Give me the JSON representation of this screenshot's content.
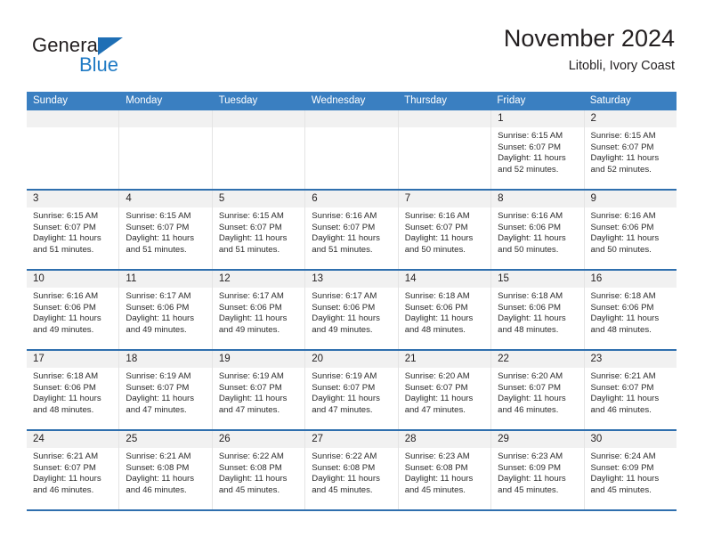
{
  "brand": {
    "name_part1": "General",
    "name_part2": "Blue",
    "logo_icon": "triangle-logo-icon"
  },
  "header": {
    "title": "November 2024",
    "subtitle": "Litobli, Ivory Coast"
  },
  "colors": {
    "header_blue": "#3a7fc1",
    "row_rule_blue": "#2f6fae",
    "day_band_gray": "#f1f1f1",
    "brand_blue": "#1f7ac4",
    "text": "#231f20"
  },
  "weekdays": [
    "Sunday",
    "Monday",
    "Tuesday",
    "Wednesday",
    "Thursday",
    "Friday",
    "Saturday"
  ],
  "weeks": [
    [
      {
        "day": "",
        "empty": true,
        "sunrise": "",
        "sunset": "",
        "daylight_l1": "",
        "daylight_l2": ""
      },
      {
        "day": "",
        "empty": true,
        "sunrise": "",
        "sunset": "",
        "daylight_l1": "",
        "daylight_l2": ""
      },
      {
        "day": "",
        "empty": true,
        "sunrise": "",
        "sunset": "",
        "daylight_l1": "",
        "daylight_l2": ""
      },
      {
        "day": "",
        "empty": true,
        "sunrise": "",
        "sunset": "",
        "daylight_l1": "",
        "daylight_l2": ""
      },
      {
        "day": "",
        "empty": true,
        "sunrise": "",
        "sunset": "",
        "daylight_l1": "",
        "daylight_l2": ""
      },
      {
        "day": "1",
        "empty": false,
        "sunrise": "Sunrise: 6:15 AM",
        "sunset": "Sunset: 6:07 PM",
        "daylight_l1": "Daylight: 11 hours",
        "daylight_l2": "and 52 minutes."
      },
      {
        "day": "2",
        "empty": false,
        "sunrise": "Sunrise: 6:15 AM",
        "sunset": "Sunset: 6:07 PM",
        "daylight_l1": "Daylight: 11 hours",
        "daylight_l2": "and 52 minutes."
      }
    ],
    [
      {
        "day": "3",
        "empty": false,
        "sunrise": "Sunrise: 6:15 AM",
        "sunset": "Sunset: 6:07 PM",
        "daylight_l1": "Daylight: 11 hours",
        "daylight_l2": "and 51 minutes."
      },
      {
        "day": "4",
        "empty": false,
        "sunrise": "Sunrise: 6:15 AM",
        "sunset": "Sunset: 6:07 PM",
        "daylight_l1": "Daylight: 11 hours",
        "daylight_l2": "and 51 minutes."
      },
      {
        "day": "5",
        "empty": false,
        "sunrise": "Sunrise: 6:15 AM",
        "sunset": "Sunset: 6:07 PM",
        "daylight_l1": "Daylight: 11 hours",
        "daylight_l2": "and 51 minutes."
      },
      {
        "day": "6",
        "empty": false,
        "sunrise": "Sunrise: 6:16 AM",
        "sunset": "Sunset: 6:07 PM",
        "daylight_l1": "Daylight: 11 hours",
        "daylight_l2": "and 51 minutes."
      },
      {
        "day": "7",
        "empty": false,
        "sunrise": "Sunrise: 6:16 AM",
        "sunset": "Sunset: 6:07 PM",
        "daylight_l1": "Daylight: 11 hours",
        "daylight_l2": "and 50 minutes."
      },
      {
        "day": "8",
        "empty": false,
        "sunrise": "Sunrise: 6:16 AM",
        "sunset": "Sunset: 6:06 PM",
        "daylight_l1": "Daylight: 11 hours",
        "daylight_l2": "and 50 minutes."
      },
      {
        "day": "9",
        "empty": false,
        "sunrise": "Sunrise: 6:16 AM",
        "sunset": "Sunset: 6:06 PM",
        "daylight_l1": "Daylight: 11 hours",
        "daylight_l2": "and 50 minutes."
      }
    ],
    [
      {
        "day": "10",
        "empty": false,
        "sunrise": "Sunrise: 6:16 AM",
        "sunset": "Sunset: 6:06 PM",
        "daylight_l1": "Daylight: 11 hours",
        "daylight_l2": "and 49 minutes."
      },
      {
        "day": "11",
        "empty": false,
        "sunrise": "Sunrise: 6:17 AM",
        "sunset": "Sunset: 6:06 PM",
        "daylight_l1": "Daylight: 11 hours",
        "daylight_l2": "and 49 minutes."
      },
      {
        "day": "12",
        "empty": false,
        "sunrise": "Sunrise: 6:17 AM",
        "sunset": "Sunset: 6:06 PM",
        "daylight_l1": "Daylight: 11 hours",
        "daylight_l2": "and 49 minutes."
      },
      {
        "day": "13",
        "empty": false,
        "sunrise": "Sunrise: 6:17 AM",
        "sunset": "Sunset: 6:06 PM",
        "daylight_l1": "Daylight: 11 hours",
        "daylight_l2": "and 49 minutes."
      },
      {
        "day": "14",
        "empty": false,
        "sunrise": "Sunrise: 6:18 AM",
        "sunset": "Sunset: 6:06 PM",
        "daylight_l1": "Daylight: 11 hours",
        "daylight_l2": "and 48 minutes."
      },
      {
        "day": "15",
        "empty": false,
        "sunrise": "Sunrise: 6:18 AM",
        "sunset": "Sunset: 6:06 PM",
        "daylight_l1": "Daylight: 11 hours",
        "daylight_l2": "and 48 minutes."
      },
      {
        "day": "16",
        "empty": false,
        "sunrise": "Sunrise: 6:18 AM",
        "sunset": "Sunset: 6:06 PM",
        "daylight_l1": "Daylight: 11 hours",
        "daylight_l2": "and 48 minutes."
      }
    ],
    [
      {
        "day": "17",
        "empty": false,
        "sunrise": "Sunrise: 6:18 AM",
        "sunset": "Sunset: 6:06 PM",
        "daylight_l1": "Daylight: 11 hours",
        "daylight_l2": "and 48 minutes."
      },
      {
        "day": "18",
        "empty": false,
        "sunrise": "Sunrise: 6:19 AM",
        "sunset": "Sunset: 6:07 PM",
        "daylight_l1": "Daylight: 11 hours",
        "daylight_l2": "and 47 minutes."
      },
      {
        "day": "19",
        "empty": false,
        "sunrise": "Sunrise: 6:19 AM",
        "sunset": "Sunset: 6:07 PM",
        "daylight_l1": "Daylight: 11 hours",
        "daylight_l2": "and 47 minutes."
      },
      {
        "day": "20",
        "empty": false,
        "sunrise": "Sunrise: 6:19 AM",
        "sunset": "Sunset: 6:07 PM",
        "daylight_l1": "Daylight: 11 hours",
        "daylight_l2": "and 47 minutes."
      },
      {
        "day": "21",
        "empty": false,
        "sunrise": "Sunrise: 6:20 AM",
        "sunset": "Sunset: 6:07 PM",
        "daylight_l1": "Daylight: 11 hours",
        "daylight_l2": "and 47 minutes."
      },
      {
        "day": "22",
        "empty": false,
        "sunrise": "Sunrise: 6:20 AM",
        "sunset": "Sunset: 6:07 PM",
        "daylight_l1": "Daylight: 11 hours",
        "daylight_l2": "and 46 minutes."
      },
      {
        "day": "23",
        "empty": false,
        "sunrise": "Sunrise: 6:21 AM",
        "sunset": "Sunset: 6:07 PM",
        "daylight_l1": "Daylight: 11 hours",
        "daylight_l2": "and 46 minutes."
      }
    ],
    [
      {
        "day": "24",
        "empty": false,
        "sunrise": "Sunrise: 6:21 AM",
        "sunset": "Sunset: 6:07 PM",
        "daylight_l1": "Daylight: 11 hours",
        "daylight_l2": "and 46 minutes."
      },
      {
        "day": "25",
        "empty": false,
        "sunrise": "Sunrise: 6:21 AM",
        "sunset": "Sunset: 6:08 PM",
        "daylight_l1": "Daylight: 11 hours",
        "daylight_l2": "and 46 minutes."
      },
      {
        "day": "26",
        "empty": false,
        "sunrise": "Sunrise: 6:22 AM",
        "sunset": "Sunset: 6:08 PM",
        "daylight_l1": "Daylight: 11 hours",
        "daylight_l2": "and 45 minutes."
      },
      {
        "day": "27",
        "empty": false,
        "sunrise": "Sunrise: 6:22 AM",
        "sunset": "Sunset: 6:08 PM",
        "daylight_l1": "Daylight: 11 hours",
        "daylight_l2": "and 45 minutes."
      },
      {
        "day": "28",
        "empty": false,
        "sunrise": "Sunrise: 6:23 AM",
        "sunset": "Sunset: 6:08 PM",
        "daylight_l1": "Daylight: 11 hours",
        "daylight_l2": "and 45 minutes."
      },
      {
        "day": "29",
        "empty": false,
        "sunrise": "Sunrise: 6:23 AM",
        "sunset": "Sunset: 6:09 PM",
        "daylight_l1": "Daylight: 11 hours",
        "daylight_l2": "and 45 minutes."
      },
      {
        "day": "30",
        "empty": false,
        "sunrise": "Sunrise: 6:24 AM",
        "sunset": "Sunset: 6:09 PM",
        "daylight_l1": "Daylight: 11 hours",
        "daylight_l2": "and 45 minutes."
      }
    ]
  ]
}
